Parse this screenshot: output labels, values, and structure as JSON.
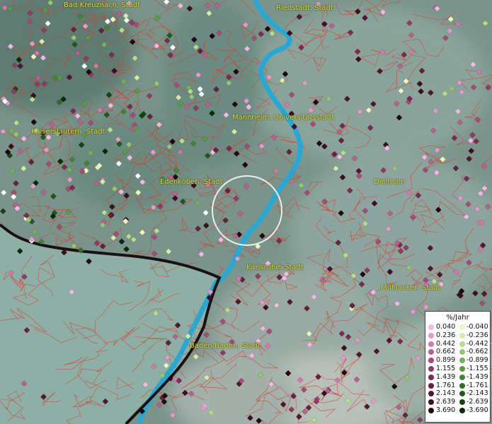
{
  "cities": [
    {
      "name": "Bad Kreuznach, Stadt"
    },
    {
      "name": "Riedstadt, Stadt"
    },
    {
      "name": "Mannheim, Universitätsstadt"
    },
    {
      "name": "Kaiserslautern, Stadt"
    },
    {
      "name": "Edenkoben, Stadt"
    },
    {
      "name": "Dielheim"
    },
    {
      "name": "Karlsruhe, Stadt"
    },
    {
      "name": "Mühlacker, Stadt"
    },
    {
      "name": "Baden-Baden, Stadt"
    }
  ],
  "legend": {
    "title": "%/Jahr",
    "positive": [
      {
        "label": "0.040",
        "color": "#f2b8e0"
      },
      {
        "label": "0.236",
        "color": "#e49ac6"
      },
      {
        "label": "0.442",
        "color": "#d07aa8"
      },
      {
        "label": "0.662",
        "color": "#bb5f8d"
      },
      {
        "label": "0.899",
        "color": "#a64a77"
      },
      {
        "label": "1.155",
        "color": "#923964"
      },
      {
        "label": "1.439",
        "color": "#7c2a52"
      },
      {
        "label": "1.761",
        "color": "#672040"
      },
      {
        "label": "2.143",
        "color": "#521631"
      },
      {
        "label": "2.639",
        "color": "#3c0e22"
      },
      {
        "label": "3.690",
        "color": "#220610"
      }
    ],
    "negative": [
      {
        "label": "-0.040",
        "color": "#eef7c0"
      },
      {
        "label": "-0.236",
        "color": "#d6eba6"
      },
      {
        "label": "-0.442",
        "color": "#b8db8c"
      },
      {
        "label": "-0.662",
        "color": "#97c673"
      },
      {
        "label": "-0.899",
        "color": "#77b05c"
      },
      {
        "label": "-1.155",
        "color": "#5a9a47"
      },
      {
        "label": "-1.439",
        "color": "#438435"
      },
      {
        "label": "-1.761",
        "color": "#2f6e27"
      },
      {
        "label": "-2.143",
        "color": "#1f5a1b"
      },
      {
        "label": "-2.639",
        "color": "#124512"
      },
      {
        "label": "-3.690",
        "color": "#062c08"
      }
    ]
  },
  "colors": {
    "river": "#2aa6d2",
    "boundary": "#d83a2c",
    "border": "#1a1010"
  }
}
